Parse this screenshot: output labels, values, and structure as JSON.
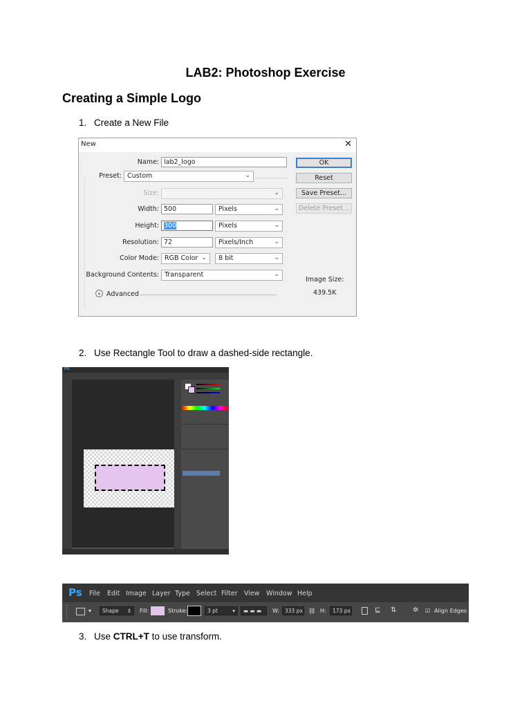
{
  "title": "LAB2: Photoshop Exercise",
  "section_heading": "Creating a Simple Logo",
  "steps": [
    {
      "num": "1.",
      "text": "Create a New File"
    },
    {
      "num": "2.",
      "text": "Use Rectangle Tool to draw a dashed-side rectangle."
    },
    {
      "num": "3.",
      "pre": "Use ",
      "bold": "CTRL+T",
      "post": " to use transform."
    }
  ],
  "new_dialog": {
    "title": "New",
    "close": "✕",
    "name_label": "Name:",
    "name_value": "lab2_logo",
    "preset_label": "Preset:",
    "preset_value": "Custom",
    "size_label": "Size:",
    "width_label": "Width:",
    "width_value": "500",
    "width_unit": "Pixels",
    "height_label": "Height:",
    "height_value": "300",
    "height_unit": "Pixels",
    "resolution_label": "Resolution:",
    "resolution_value": "72",
    "resolution_unit": "Pixels/Inch",
    "color_mode_label": "Color Mode:",
    "color_mode_value": "RGB Color",
    "bit_depth_value": "8 bit",
    "background_label": "Background Contents:",
    "background_value": "Transparent",
    "advanced_label": "Advanced",
    "buttons": {
      "ok": "OK",
      "reset": "Reset",
      "save_preset": "Save Preset...",
      "delete_preset": "Delete Preset..."
    },
    "image_size_label": "Image Size:",
    "image_size_value": "439.5K"
  },
  "ps_optionsbar": {
    "logo": "Ps",
    "menu": [
      "File",
      "Edit",
      "Image",
      "Layer",
      "Type",
      "Select",
      "Filter",
      "View",
      "Window",
      "Help"
    ],
    "mode_value": "Shape",
    "fill_label": "Fill:",
    "stroke_label": "Stroke:",
    "stroke_width": "3 pt",
    "w_label": "W:",
    "w_value": "333 px",
    "h_label": "H:",
    "h_value": "173 px",
    "align_edges": "Align Edges"
  },
  "colors": {
    "fill": "#e6c4f0",
    "stroke": "#000000",
    "ps_blue": "#31a8ff"
  }
}
